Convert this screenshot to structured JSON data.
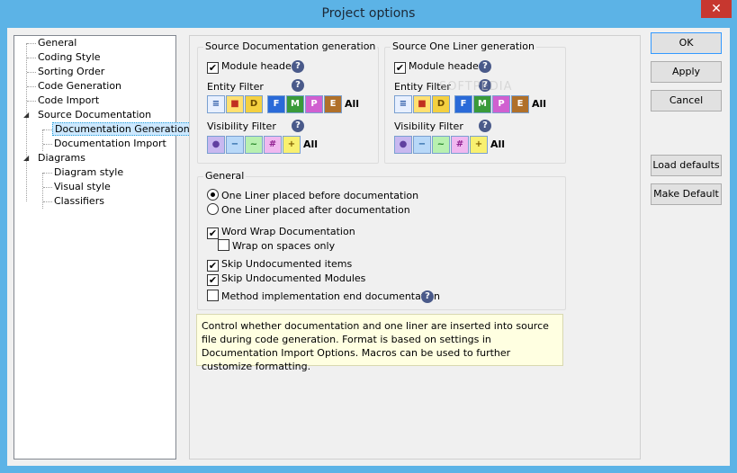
{
  "window": {
    "title": "Project options",
    "close_glyph": "✕"
  },
  "tree": {
    "items": [
      {
        "label": "General"
      },
      {
        "label": "Coding Style"
      },
      {
        "label": "Sorting Order"
      },
      {
        "label": "Code Generation"
      },
      {
        "label": "Code Import"
      },
      {
        "label": "Source Documentation"
      },
      {
        "label": "Documentation Generation"
      },
      {
        "label": "Documentation Import"
      },
      {
        "label": "Diagrams"
      },
      {
        "label": "Diagram style"
      },
      {
        "label": "Visual style"
      },
      {
        "label": "Classifiers"
      }
    ],
    "expanded_glyph": "◢"
  },
  "source_doc": {
    "title": "Source Documentation generation",
    "module_header": "Module header",
    "entity_filter": "Entity Filter",
    "visibility_filter": "Visibility Filter",
    "all": "All"
  },
  "one_liner": {
    "title": "Source One Liner generation",
    "module_header": "Module header",
    "entity_filter": "Entity Filter",
    "visibility_filter": "Visibility Filter",
    "all": "All"
  },
  "entity_icons": [
    {
      "icon": "text-icon",
      "glyph": "≡",
      "color": "#e8f0ff",
      "fg": "#2050a0"
    },
    {
      "icon": "shapes-icon",
      "glyph": "■",
      "color": "#ffe070",
      "fg": "#c03020"
    },
    {
      "icon": "d-icon",
      "glyph": "D",
      "color": "#f4d040",
      "fg": "#6a4a00"
    },
    {
      "icon": "f-icon",
      "glyph": "F",
      "color": "#2a6ad8",
      "fg": "#ffffff"
    },
    {
      "icon": "m-icon",
      "glyph": "M",
      "color": "#3a9a3a",
      "fg": "#ffffff"
    },
    {
      "icon": "p-icon",
      "glyph": "P",
      "color": "#d060d0",
      "fg": "#ffffff"
    },
    {
      "icon": "e-icon",
      "glyph": "E",
      "color": "#b0702a",
      "fg": "#ffffff"
    }
  ],
  "visibility_icons": [
    {
      "icon": "private-icon",
      "glyph": "●",
      "color": "#c8b8f0",
      "fg": "#6040a0"
    },
    {
      "icon": "protected-icon",
      "glyph": "−",
      "color": "#b8d8f8",
      "fg": "#2060a0"
    },
    {
      "icon": "package-icon",
      "glyph": "~",
      "color": "#b8f0b0",
      "fg": "#208020"
    },
    {
      "icon": "internal-icon",
      "glyph": "#",
      "color": "#f0b8f0",
      "fg": "#902090"
    },
    {
      "icon": "public-icon",
      "glyph": "+",
      "color": "#f8f070",
      "fg": "#806000"
    }
  ],
  "general": {
    "title": "General",
    "radio_before": "One Liner placed before documentation",
    "radio_after": "One Liner placed after documentation",
    "word_wrap": "Word Wrap Documentation",
    "wrap_spaces": "Wrap on spaces only",
    "skip_items": "Skip Undocumented items",
    "skip_modules": "Skip Undocumented Modules",
    "method_end": "Method implementation end documentation"
  },
  "info_text": "Control whether documentation and one liner are inserted into source file during code generation. Format is based on settings in Documentation Import Options. Macros can be used to further customize formatting.",
  "buttons": {
    "ok": "OK",
    "apply": "Apply",
    "cancel": "Cancel",
    "load_defaults": "Load defaults",
    "make_default": "Make Default"
  },
  "help_glyph": "?",
  "check_glyph": "✔",
  "watermark": "SOFTPEDIA"
}
